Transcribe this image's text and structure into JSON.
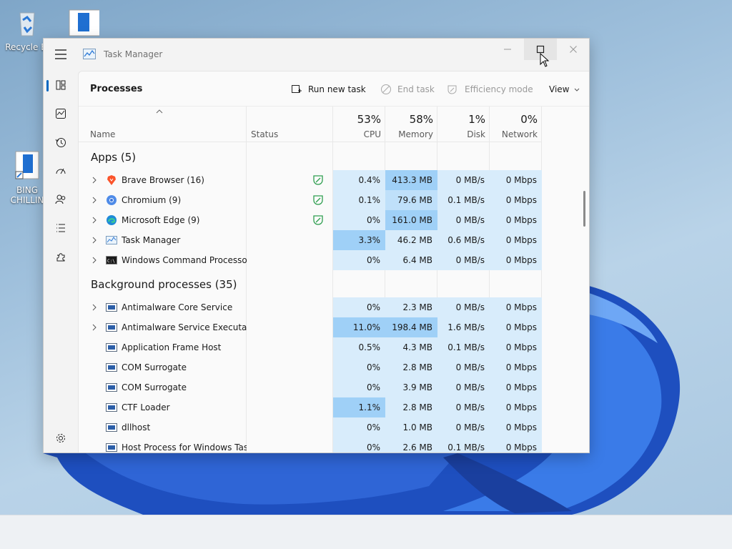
{
  "desktop": {
    "icons": [
      {
        "label": "Recycle Bi",
        "icon": "recycle-bin-icon"
      },
      {
        "label": "",
        "icon": "app-shortcut-icon"
      },
      {
        "label": "BING\nCHILLIN",
        "icon": "shortcut-icon"
      }
    ]
  },
  "window": {
    "title": "Task Manager",
    "page_title": "Processes",
    "commands": {
      "run_new_task": "Run new task",
      "end_task": "End task",
      "efficiency_mode": "Efficiency mode",
      "view": "View"
    },
    "columns": {
      "name": "Name",
      "status": "Status",
      "cpu": {
        "pct": "53%",
        "label": "CPU"
      },
      "memory": {
        "pct": "58%",
        "label": "Memory"
      },
      "disk": {
        "pct": "1%",
        "label": "Disk"
      },
      "network": {
        "pct": "0%",
        "label": "Network"
      }
    },
    "groups": {
      "apps": "Apps (5)",
      "background": "Background processes (35)"
    },
    "apps": [
      {
        "name": "Brave Browser (16)",
        "icon": "brave-icon",
        "efficiency": true,
        "cpu": "0.4%",
        "memory": "413.3 MB",
        "disk": "0 MB/s",
        "network": "0 Mbps"
      },
      {
        "name": "Chromium (9)",
        "icon": "chromium-icon",
        "efficiency": true,
        "cpu": "0.1%",
        "memory": "79.6 MB",
        "disk": "0.1 MB/s",
        "network": "0 Mbps"
      },
      {
        "name": "Microsoft Edge (9)",
        "icon": "edge-icon",
        "efficiency": true,
        "cpu": "0%",
        "memory": "161.0 MB",
        "disk": "0 MB/s",
        "network": "0 Mbps"
      },
      {
        "name": "Task Manager",
        "icon": "task-manager-icon",
        "efficiency": false,
        "cpu": "3.3%",
        "memory": "46.2 MB",
        "disk": "0.6 MB/s",
        "network": "0 Mbps"
      },
      {
        "name": "Windows Command Processo...",
        "icon": "cmd-icon",
        "efficiency": false,
        "cpu": "0%",
        "memory": "6.4 MB",
        "disk": "0 MB/s",
        "network": "0 Mbps"
      }
    ],
    "background": [
      {
        "name": "Antimalware Core Service",
        "expandable": true,
        "cpu": "0%",
        "memory": "2.3 MB",
        "disk": "0 MB/s",
        "network": "0 Mbps"
      },
      {
        "name": "Antimalware Service Executable",
        "expandable": true,
        "cpu": "11.0%",
        "memory": "198.4 MB",
        "disk": "1.6 MB/s",
        "network": "0 Mbps"
      },
      {
        "name": "Application Frame Host",
        "expandable": false,
        "cpu": "0.5%",
        "memory": "4.3 MB",
        "disk": "0.1 MB/s",
        "network": "0 Mbps"
      },
      {
        "name": "COM Surrogate",
        "expandable": false,
        "cpu": "0%",
        "memory": "2.8 MB",
        "disk": "0 MB/s",
        "network": "0 Mbps"
      },
      {
        "name": "COM Surrogate",
        "expandable": false,
        "cpu": "0%",
        "memory": "3.9 MB",
        "disk": "0 MB/s",
        "network": "0 Mbps"
      },
      {
        "name": "CTF Loader",
        "expandable": false,
        "cpu": "1.1%",
        "memory": "2.8 MB",
        "disk": "0 MB/s",
        "network": "0 Mbps"
      },
      {
        "name": "dllhost",
        "expandable": false,
        "cpu": "0%",
        "memory": "1.0 MB",
        "disk": "0 MB/s",
        "network": "0 Mbps"
      },
      {
        "name": "Host Process for Windows Tasks",
        "expandable": false,
        "cpu": "0%",
        "memory": "2.6 MB",
        "disk": "0.1 MB/s",
        "network": "0 Mbps"
      }
    ]
  },
  "colors": {
    "accent": "#0067c0",
    "heat_low": "#d8ecfb",
    "heat_mid": "#bfe0fa",
    "heat_high": "#9fd0f7"
  }
}
